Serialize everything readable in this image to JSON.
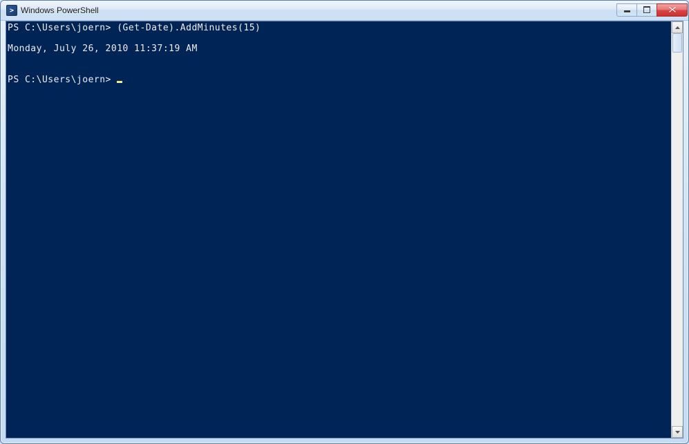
{
  "window": {
    "title": "Windows PowerShell"
  },
  "console": {
    "prompt1": "PS C:\\Users\\joern>",
    "command1": "(Get-Date).AddMinutes(15)",
    "blank1": "",
    "output1": "Monday, July 26, 2010 11:37:19 AM",
    "blank2": "",
    "blank3": "",
    "prompt2": "PS C:\\Users\\joern>"
  }
}
